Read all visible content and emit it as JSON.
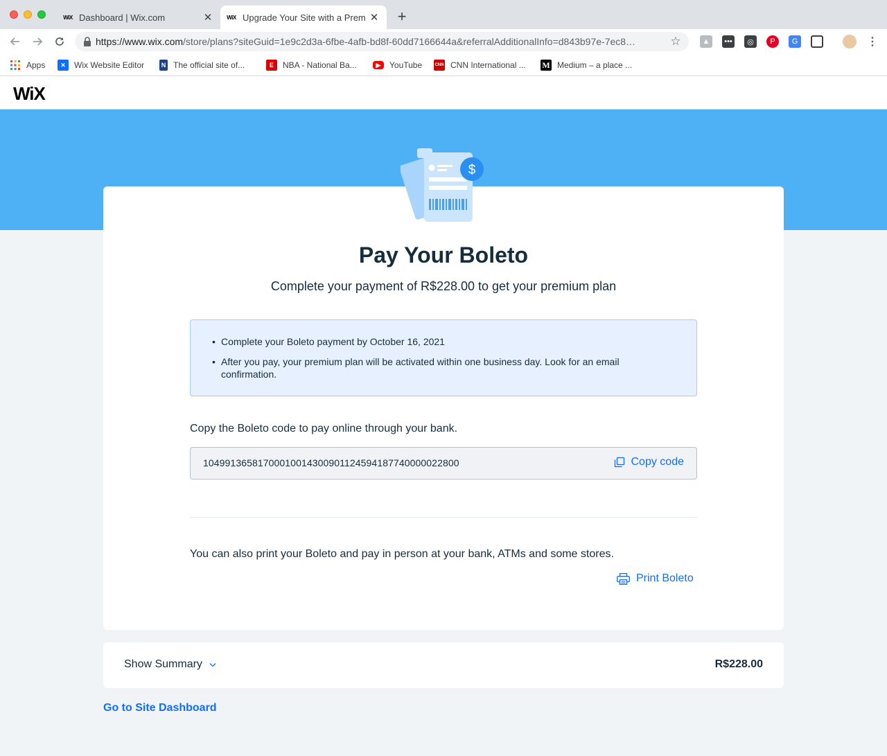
{
  "browser": {
    "tabs": [
      {
        "favicon": "WiX",
        "title": "Dashboard | Wix.com",
        "close": "✕"
      },
      {
        "favicon": "WiX",
        "title": "Upgrade Your Site with a Prem",
        "close": "✕"
      }
    ],
    "new_tab": "+",
    "url_host": "https://www.wix.com",
    "url_path": "/store/plans?siteGuid=1e9c2d3a-6fbe-4afb-bd8f-60dd7166644a&referralAdditionalInfo=d843b97e-7ec8…",
    "bookmarks": [
      {
        "label": "Apps",
        "icon": "apps-grid-icon"
      },
      {
        "label": "Wix Website Editor",
        "icon": "wix-editor-icon"
      },
      {
        "label": "The official site of...",
        "icon": "nba-icon"
      },
      {
        "label": "NBA - National Ba...",
        "icon": "espn-icon"
      },
      {
        "label": "YouTube",
        "icon": "youtube-icon"
      },
      {
        "label": "CNN International ...",
        "icon": "cnn-icon"
      },
      {
        "label": "Medium – a place ...",
        "icon": "medium-icon"
      }
    ],
    "bookmark_icon_text": {
      "espn": "E",
      "cnn": "CNN",
      "medium": "M",
      "nba": "N"
    },
    "extension_icons": [
      "drive-icon",
      "password-icon",
      "lighthouse-icon",
      "pinterest-icon",
      "translate-icon",
      "screenshot-icon",
      "profile-avatar",
      "menu-icon"
    ]
  },
  "header": {
    "logo": "WiX"
  },
  "colors": {
    "hero": "#4eb1f5",
    "accent": "#116dff",
    "info_bg": "#e7f0ff",
    "text": "#162d3d"
  },
  "payment": {
    "title": "Pay Your Boleto",
    "subtitle": "Complete your payment of R$228.00 to get your premium plan",
    "info_items": [
      "Complete your Boleto payment by October 16, 2021",
      "After you pay, your premium plan will be activated within one business day. Look for an email confirmation."
    ],
    "copy_label": "Copy the Boleto code to pay online through your bank.",
    "boleto_code": "10499136581700010014300901124594187740000022800",
    "copy_button": "Copy code",
    "print_text": "You can also print your Boleto and pay in person at your bank, ATMs and some stores.",
    "print_button": "Print Boleto"
  },
  "summary": {
    "toggle_label": "Show Summary",
    "total": "R$228.00"
  },
  "footer": {
    "dashboard_link": "Go to Site Dashboard"
  }
}
